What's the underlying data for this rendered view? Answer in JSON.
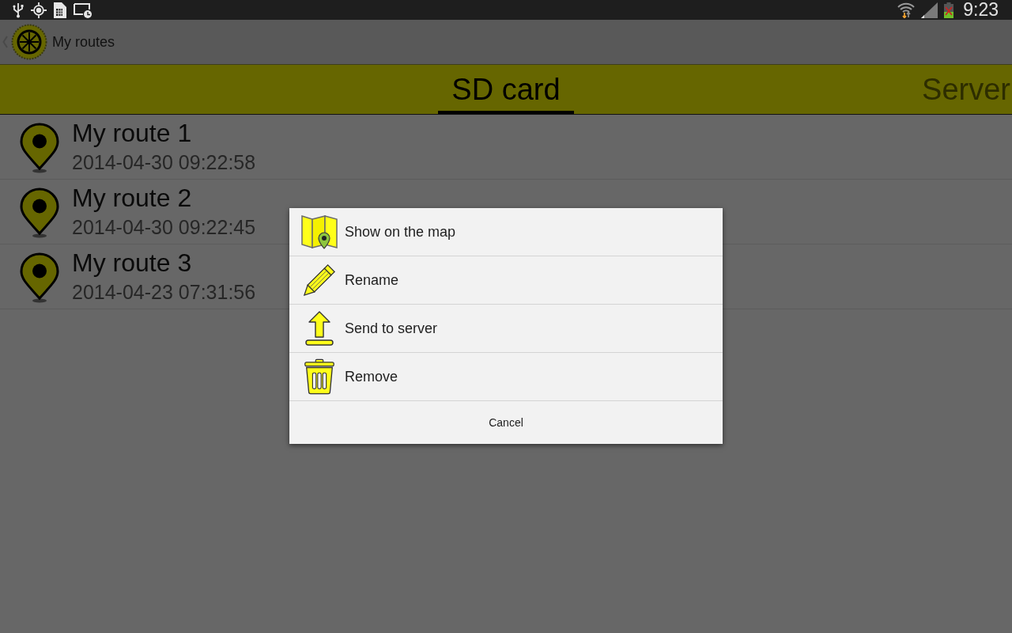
{
  "status_bar": {
    "time": "9:23"
  },
  "action_bar": {
    "title": "My routes"
  },
  "tabs": [
    {
      "label": "SD card",
      "selected": true
    },
    {
      "label": "Server",
      "selected": false
    }
  ],
  "routes": [
    {
      "name": "My route 1",
      "date": "2014-04-30 09:22:58"
    },
    {
      "name": "My route 2",
      "date": "2014-04-30 09:22:45"
    },
    {
      "name": "My route 3",
      "date": "2014-04-23 07:31:56"
    }
  ],
  "context_menu": {
    "items": [
      {
        "kind": "show",
        "label": "Show on the map"
      },
      {
        "kind": "rename",
        "label": "Rename"
      },
      {
        "kind": "send",
        "label": "Send to server"
      },
      {
        "kind": "remove",
        "label": "Remove"
      }
    ],
    "cancel": "Cancel"
  }
}
